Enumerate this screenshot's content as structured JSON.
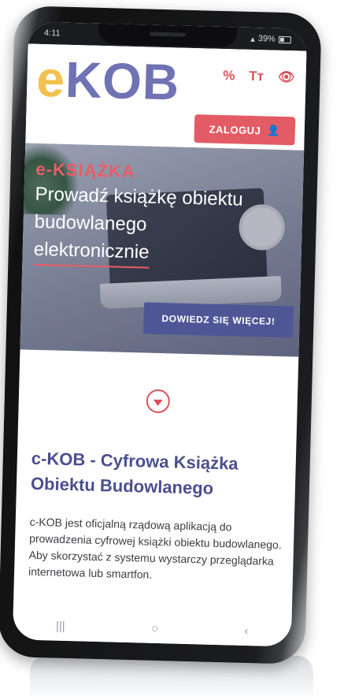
{
  "status": {
    "time": "4:11",
    "signal": "4",
    "battery": "39%"
  },
  "header": {
    "logo_e": "e",
    "logo_kob": "KOB",
    "tools": {
      "contrast": "%",
      "text_size": "Tт",
      "visibility": "👁"
    },
    "login_label": "ZALOGUJ"
  },
  "hero": {
    "tag": "e-KSIĄŻKA",
    "line1": "Prowadź książkę obiektu",
    "line2": "budowlanego",
    "line3": "elektronicznie",
    "button": "DOWIEDZ SIĘ WIĘCEJ!"
  },
  "section": {
    "title": "c-KOB - Cyfrowa Książka Obiektu Budowlanego",
    "body": "c-KOB jest oficjalną rządową aplikacją do prowadzenia cyfrowej książki obiektu budowlanego. Aby skorzystać z systemu wystarczy przeglądarka internetowa lub smartfon."
  },
  "nav": {
    "recent": "|||",
    "home": "○",
    "back": "‹"
  },
  "colors": {
    "accent_red": "#e35c65",
    "brand_purple": "#6f72b3",
    "brand_yellow": "#f2c14e",
    "button_blue": "#4f5696"
  }
}
